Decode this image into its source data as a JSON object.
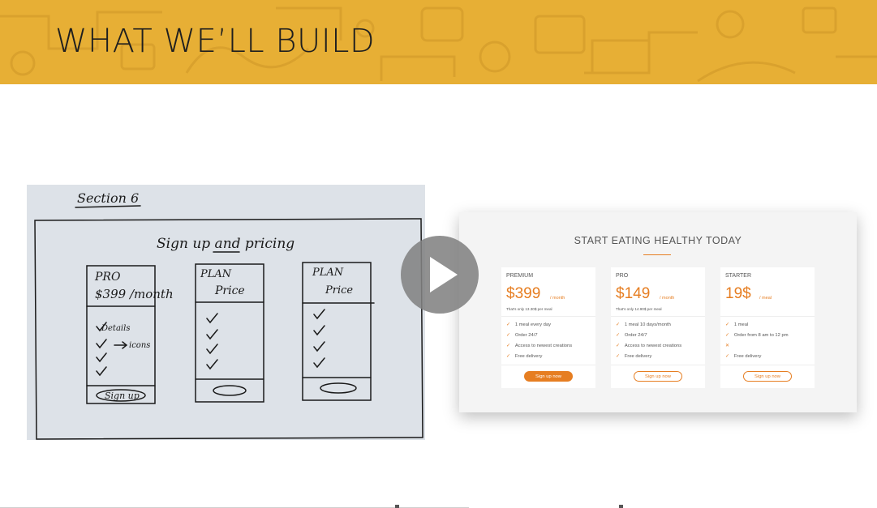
{
  "banner": {
    "title": "WHAT WE’LL BUILD",
    "background_color": "#e7af35"
  },
  "sketch": {
    "section_label": "Section 6",
    "heading": "Sign up and pricing",
    "cards": [
      {
        "plan": "PRO",
        "price": "$399 /month",
        "lines": [
          "Details",
          "icons"
        ],
        "button": "Sign up"
      },
      {
        "plan": "PLAN",
        "price": "Price",
        "lines": [],
        "button": ""
      },
      {
        "plan": "PLAN",
        "price": "Price",
        "lines": [],
        "button": ""
      }
    ]
  },
  "pricing": {
    "heading": "START EATING HEALTHY TODAY",
    "accent_color": "#e67e22",
    "plans": [
      {
        "name": "PREMIUM",
        "price": "$399",
        "period": "/ month",
        "note": "That's only 13.30$ per meal",
        "features": [
          "1 meal every day",
          "Order 24/7",
          "Access to newest creations",
          "Free delivery"
        ],
        "button": "Sign up now",
        "button_style": "full"
      },
      {
        "name": "PRO",
        "price": "$149",
        "period": "/ month",
        "note": "That's only 14.90$ per meal",
        "features": [
          "1 meal 10 days/month",
          "Order 24/7",
          "Access to newest creations",
          "Free delivery"
        ],
        "button": "Sign up now",
        "button_style": "ghost"
      },
      {
        "name": "STARTER",
        "price": "19$",
        "period": "/ meal",
        "note": "",
        "features": [
          "1 meal",
          "Order from 8 am to 12 pm",
          "",
          "Free delivery"
        ],
        "button": "Sign up now",
        "button_style": "ghost"
      }
    ]
  },
  "player": {
    "play_icon": "play-icon"
  }
}
